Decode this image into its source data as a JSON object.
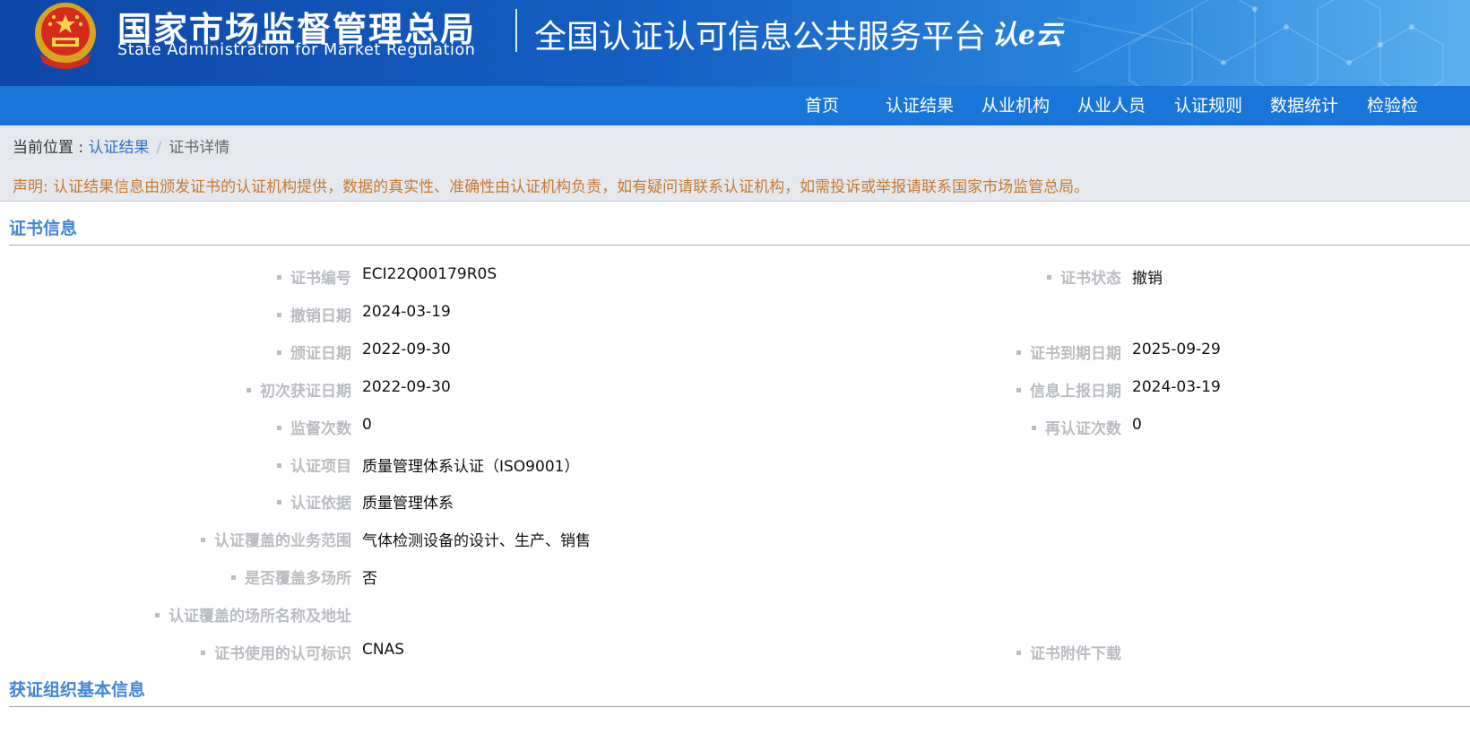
{
  "header": {
    "agency_cn": "国家市场监督管理总局",
    "agency_en": "State Administration  for  Market Regulation",
    "platform_title": "全国认证认可信息公共服务平台",
    "logo_text": "认e云",
    "emblem": "national-emblem-icon"
  },
  "nav": {
    "items": [
      {
        "label": "首页"
      },
      {
        "label": "认证结果"
      },
      {
        "label": "从业机构"
      },
      {
        "label": "从业人员"
      },
      {
        "label": "认证规则"
      },
      {
        "label": "数据统计"
      },
      {
        "label": "检验检"
      }
    ]
  },
  "breadcrumb": {
    "prefix": "当前位置 : ",
    "link": "认证结果",
    "separator": "/",
    "current": "证书详情"
  },
  "notice": "声明: 认证结果信息由颁发证书的认证机构提供，数据的真实性、准确性由认证机构负责，如有疑问请联系认证机构，如需投诉或举报请联系国家市场监管总局。",
  "certificate": {
    "section_title": "证书信息",
    "cert_no_label": "证书编号",
    "cert_no": "ECI22Q00179R0S",
    "status_label": "证书状态",
    "status": "撤销",
    "revoke_date_label": "撤销日期",
    "revoke_date": "2024-03-19",
    "issue_date_label": "颁证日期",
    "issue_date": "2022-09-30",
    "expiry_label": "证书到期日期",
    "expiry": "2025-09-29",
    "first_date_label": "初次获证日期",
    "first_date": "2022-09-30",
    "report_date_label": "信息上报日期",
    "report_date": "2024-03-19",
    "audit_count_label": "监督次数",
    "audit_count": "0",
    "recert_count_label": "再认证次数",
    "recert_count": "0",
    "project_label": "认证项目",
    "project": "质量管理体系认证（ISO9001）",
    "basis_label": "认证依据",
    "basis": "质量管理体系",
    "scope_label": "认证覆盖的业务范围",
    "scope": "气体检测设备的设计、生产、销售",
    "multi_site_label": "是否覆盖多场所",
    "multi_site": "否",
    "site_address_label": "认证覆盖的场所名称及地址",
    "site_address": "",
    "accred_mark_label": "证书使用的认可标识",
    "accred_mark": "CNAS",
    "attachment_label": "证书附件下载"
  },
  "organization": {
    "section_title": "获证组织基本信息"
  },
  "colors": {
    "nav_bg": "#1976d8",
    "section_title": "#3f86d8",
    "notice": "#c8782f",
    "label": "#b9bcc1"
  }
}
